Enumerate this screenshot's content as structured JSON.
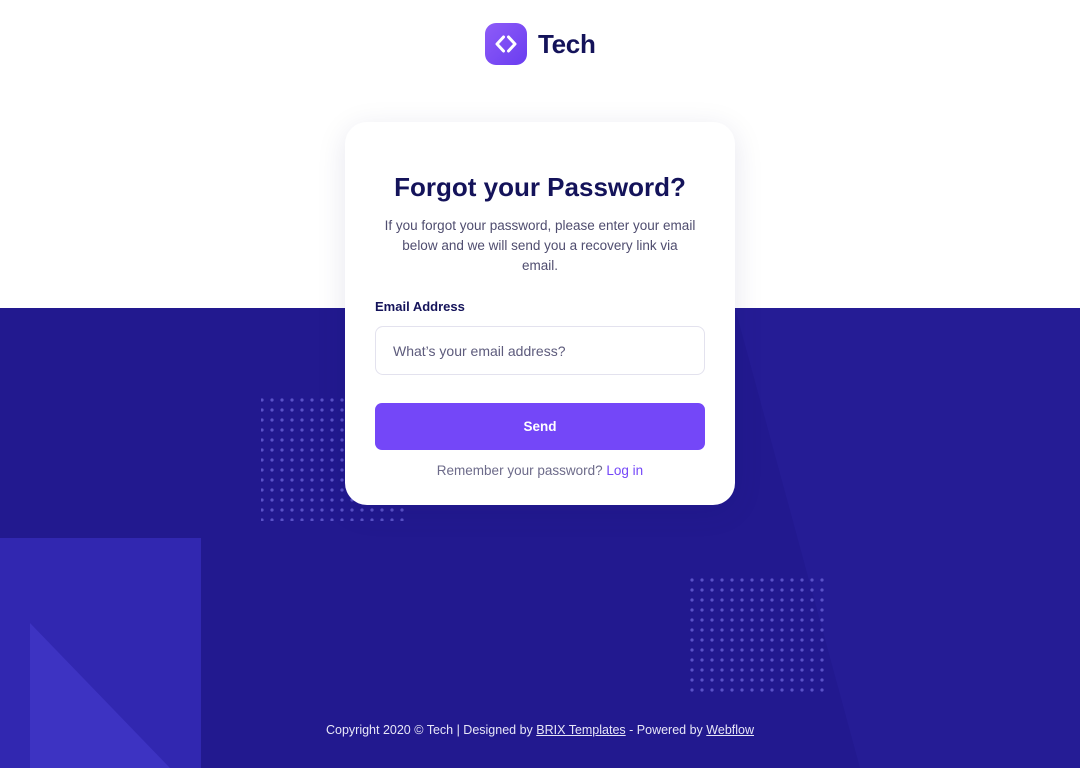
{
  "brand": {
    "name": "Tech",
    "logo_icon": "code-brackets-icon",
    "accent_color": "#7447f8",
    "dark_color": "#14135a",
    "background_color": "#22198f"
  },
  "card": {
    "title": "Forgot your Password?",
    "description": "If you forgot your password, please enter your email below and we will send you a recovery link via email.",
    "email_label": "Email Address",
    "email_placeholder": "What’s your email address?",
    "email_value": "",
    "send_label": "Send",
    "remember_text": "Remember your password?",
    "login_label": "Log in"
  },
  "footer": {
    "copyright": "Copyright 2020 © Tech | Designed by",
    "brix_label": "BRIX Templates",
    "powered_text": "- Powered by",
    "webflow_label": "Webflow"
  }
}
